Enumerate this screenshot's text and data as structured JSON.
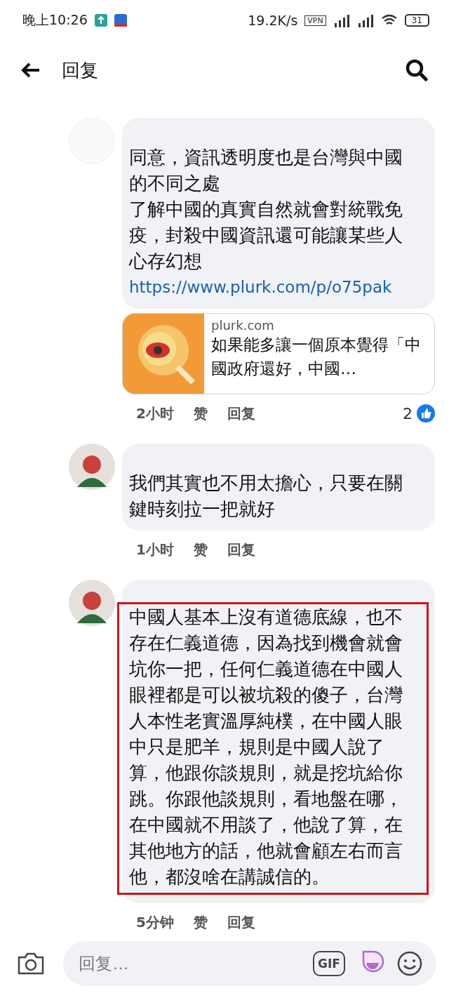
{
  "status_bar": {
    "time": "晚上10:26",
    "speed": "19.2K/s",
    "vpn": "VPN",
    "battery": "31"
  },
  "header": {
    "title": "回复"
  },
  "comments": [
    {
      "avatar_visible": false,
      "paragraphs": [
        "同意，資訊透明度也是台灣與中國的不同之處",
        "了解中國的真實自然就會對統戰免疫，封殺中國資訊還可能讓某些人心存幻想"
      ],
      "link": "https://www.plurk.com/p/o75pak",
      "preview": {
        "site": "plurk.com",
        "title": "如果能多讓一個原本覺得「中國政府還好，中國…"
      },
      "time": "2小时",
      "like": "赞",
      "reply": "回复",
      "reactions": "2",
      "highlighted": false
    },
    {
      "avatar_visible": true,
      "paragraphs": [
        "我們其實也不用太擔心，只要在關鍵時刻拉一把就好"
      ],
      "time": "1小时",
      "like": "赞",
      "reply": "回复",
      "highlighted": false
    },
    {
      "avatar_visible": true,
      "paragraphs": [
        "中國人基本上沒有道德底線，也不存在仁義道德，因為找到機會就會坑你一把，任何仁義道德在中國人眼裡都是可以被坑殺的傻子，台灣人本性老實溫厚純樸，在中國人眼中只是肥羊，規則是中國人說了算，他跟你談規則，就是挖坑給你跳。你跟他談規則，看地盤在哪，在中國就不用談了，他說了算，在其他地方的話，他就會顧左右而言他，都沒啥在講誠信的。"
      ],
      "time": "5分钟",
      "like": "赞",
      "reply": "回复",
      "highlighted": true
    }
  ],
  "composer": {
    "placeholder": "回复…",
    "gif": "GIF"
  }
}
